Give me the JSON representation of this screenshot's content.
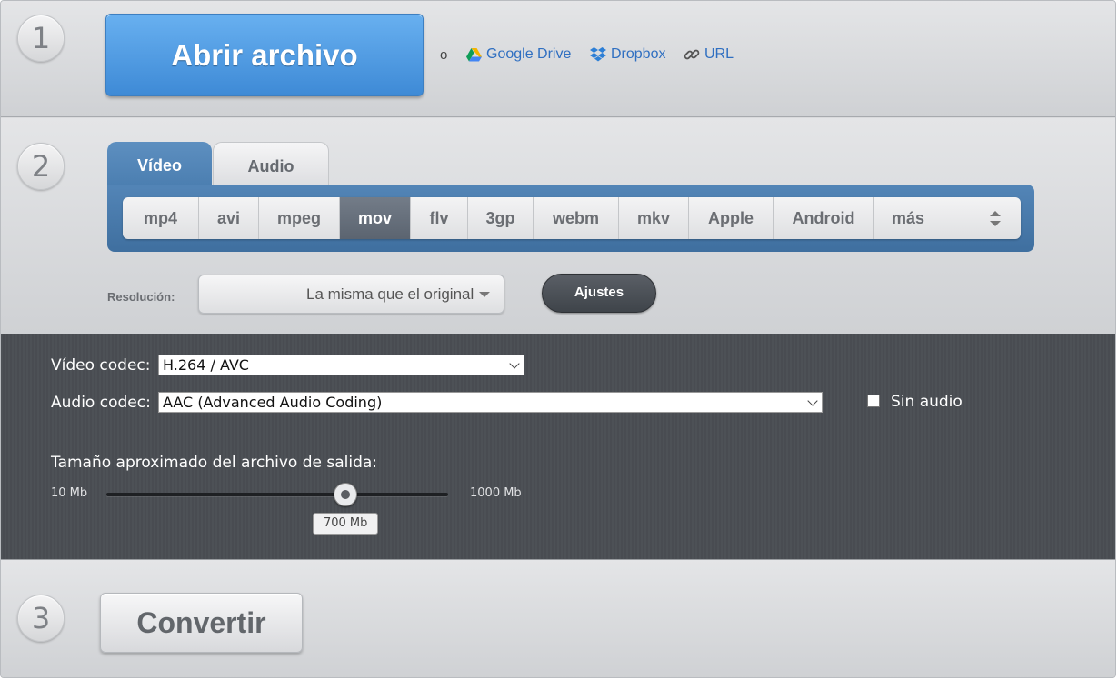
{
  "steps": [
    "1",
    "2",
    "3"
  ],
  "open": {
    "button_label": "Abrir archivo",
    "or_text": "o",
    "sources": [
      {
        "label": "Google Drive",
        "icon": "google-drive-icon"
      },
      {
        "label": "Dropbox",
        "icon": "dropbox-icon"
      },
      {
        "label": "URL",
        "icon": "link-icon"
      }
    ]
  },
  "tabs": [
    {
      "label": "Vídeo",
      "active": true
    },
    {
      "label": "Audio",
      "active": false
    }
  ],
  "formats": [
    "mp4",
    "avi",
    "mpeg",
    "mov",
    "flv",
    "3gp",
    "webm",
    "mkv",
    "Apple",
    "Android",
    "más"
  ],
  "selected_format": "mov",
  "resolution": {
    "label": "Resolución:",
    "value": "La misma que el original"
  },
  "settings_button": "Ajustes",
  "settings": {
    "video_codec_label": "Vídeo codec:",
    "video_codec_value": "H.264 / AVC",
    "audio_codec_label": "Audio codec:",
    "audio_codec_value": "AAC (Advanced Audio Coding)",
    "no_audio_label": "Sin audio",
    "no_audio_checked": false,
    "size_label": "Tamaño aproximado del archivo de salida:",
    "size_min": "10 Mb",
    "size_max": "1000 Mb",
    "size_value": "700 Mb",
    "size_fraction": 0.7
  },
  "convert_button": "Convertir",
  "colors": {
    "accent_blue": "#4b8ad6",
    "tab_blue": "#4b7eb0",
    "panel_dark": "#4a4e53"
  }
}
